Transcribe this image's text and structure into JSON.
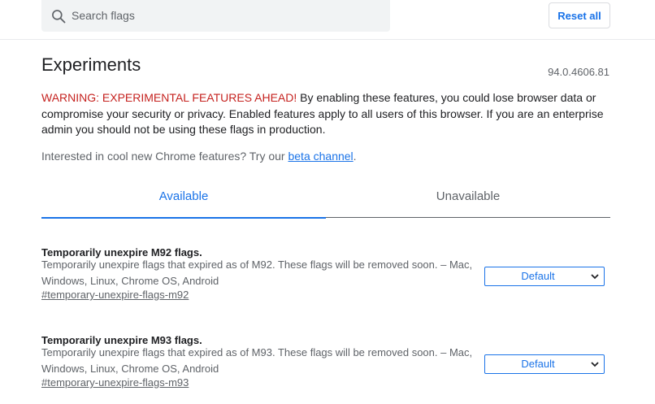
{
  "search": {
    "placeholder": "Search flags"
  },
  "reset_label": "Reset all",
  "title": "Experiments",
  "version": "94.0.4606.81",
  "warning": {
    "title": "WARNING: EXPERIMENTAL FEATURES AHEAD!",
    "body": " By enabling these features, you could lose browser data or compromise your security or privacy. Enabled features apply to all users of this browser. If you are an enterprise admin you should not be using these flags in production."
  },
  "interest": {
    "prefix": "Interested in cool new Chrome features? Try our ",
    "link": "beta channel",
    "suffix": "."
  },
  "tabs": [
    {
      "label": "Available"
    },
    {
      "label": "Unavailable"
    }
  ],
  "flags": [
    {
      "name": "Temporarily unexpire M92 flags.",
      "description": "Temporarily unexpire flags that expired as of M92. These flags will be removed soon. – Mac, Windows, Linux, Chrome OS, Android",
      "link": "#temporary-unexpire-flags-m92",
      "selected": "Default"
    },
    {
      "name": "Temporarily unexpire M93 flags.",
      "description": "Temporarily unexpire flags that expired as of M93. These flags will be removed soon. – Mac, Windows, Linux, Chrome OS, Android",
      "link": "#temporary-unexpire-flags-m93",
      "selected": "Default"
    }
  ],
  "colors": {
    "accent": "#1a73e8",
    "warning": "#c5221f",
    "secondary_text": "#5f6368"
  }
}
